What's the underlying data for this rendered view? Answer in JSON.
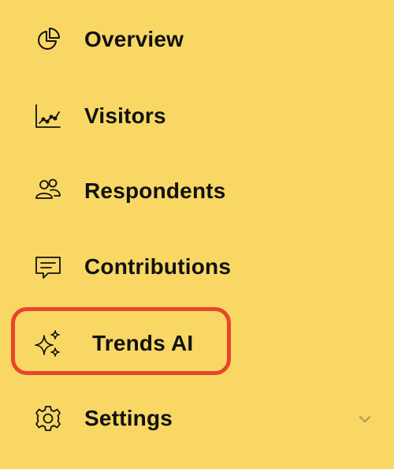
{
  "sidebar": {
    "items": [
      {
        "label": "Overview",
        "icon": "pie-chart-icon"
      },
      {
        "label": "Visitors",
        "icon": "line-chart-icon"
      },
      {
        "label": "Respondents",
        "icon": "users-icon"
      },
      {
        "label": "Contributions",
        "icon": "message-icon"
      },
      {
        "label": "Trends AI",
        "icon": "sparkles-icon",
        "highlighted": true
      },
      {
        "label": "Settings",
        "icon": "gear-icon",
        "expandable": true
      }
    ]
  },
  "colors": {
    "background": "#f8d764",
    "highlight_border": "#e8452c",
    "text": "#111111",
    "chevron": "#b09a4a"
  }
}
